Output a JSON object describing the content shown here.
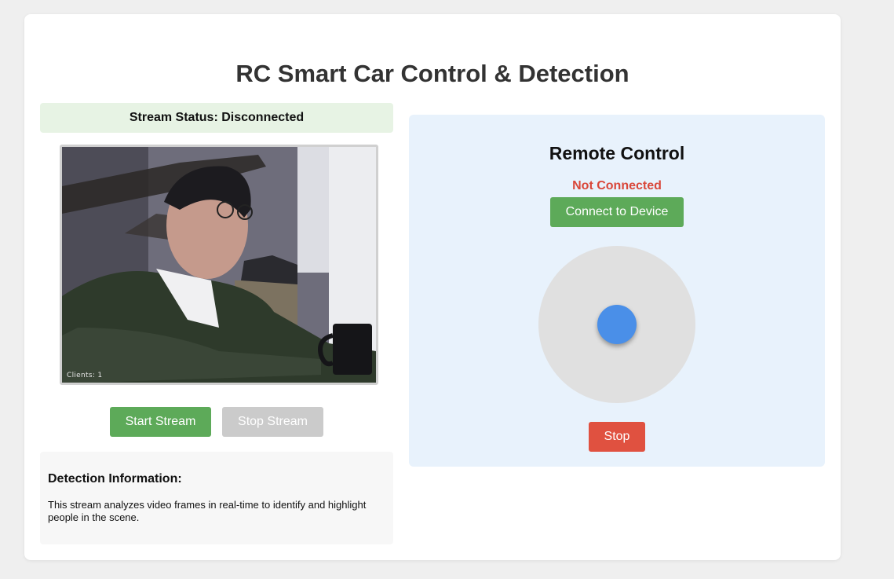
{
  "page": {
    "title": "RC Smart Car Control & Detection"
  },
  "stream": {
    "status_text": "Stream Status: Disconnected",
    "overlay_text": "Clients: 1",
    "start_label": "Start Stream",
    "stop_label": "Stop Stream"
  },
  "detection": {
    "title": "Detection Information:",
    "text": "This stream analyzes video frames in real-time to identify and highlight people in the scene."
  },
  "remote": {
    "title": "Remote Control",
    "connection_status": "Not Connected",
    "connect_label": "Connect to Device",
    "stop_label": "Stop"
  },
  "colors": {
    "accent_green": "#5daa59",
    "disabled_gray": "#cbcbcb",
    "danger_red": "#e05140",
    "status_red": "#d9473a",
    "joystick_blue": "#4a8fe8",
    "panel_blue": "#e8f2fc",
    "status_bg_green": "#e7f3e4"
  }
}
